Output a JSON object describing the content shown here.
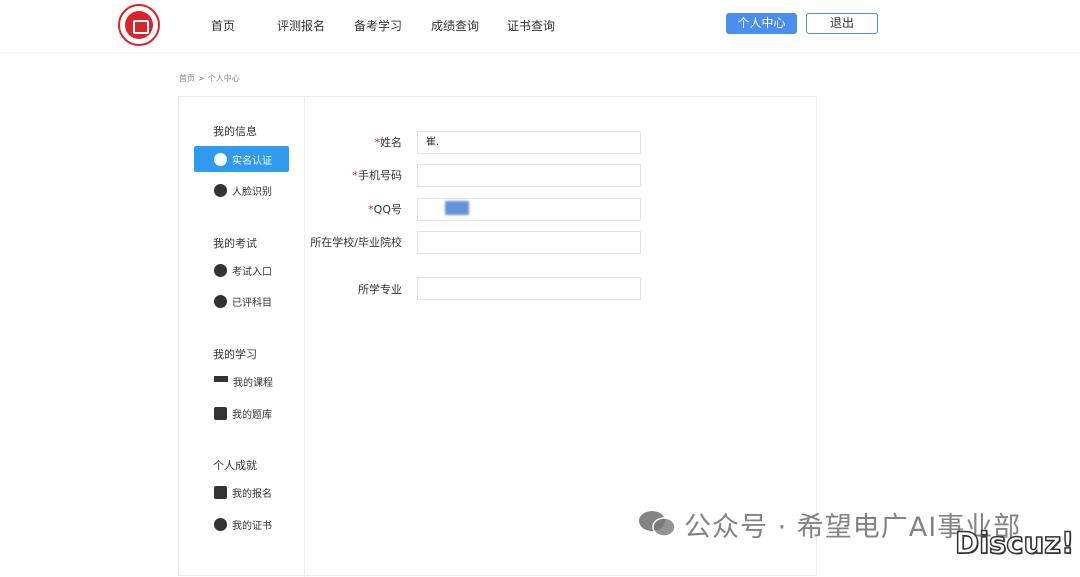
{
  "header": {
    "nav": [
      "首页",
      "评测报名",
      "备考学习",
      "成绩查询",
      "证书查询"
    ],
    "center_button": "个人中心",
    "logout_button": "退出"
  },
  "breadcrumb": [
    "首页",
    ">",
    "个人中心"
  ],
  "sidebar": {
    "groups": [
      {
        "title": "我的信息",
        "items": [
          "实名认证",
          "人脸识别"
        ]
      },
      {
        "title": "我的考试",
        "items": [
          "考试入口",
          "已评科目"
        ]
      },
      {
        "title": "我的学习",
        "items": [
          "我的课程",
          "我的题库"
        ]
      },
      {
        "title": "个人成就",
        "items": [
          "我的报名",
          "我的证书"
        ]
      }
    ],
    "active_item": "实名认证"
  },
  "form": {
    "required_mark": "*",
    "fields": [
      {
        "label": "姓名",
        "value": "崔.",
        "required": true
      },
      {
        "label": "手机号码",
        "value": "",
        "required": true
      },
      {
        "label": "QQ号",
        "value": "",
        "required": true
      },
      {
        "label": "所在学校/毕业院校",
        "value": "",
        "required": false
      },
      {
        "label": "所学专业",
        "value": "",
        "required": false
      }
    ]
  },
  "watermark": {
    "text": "公众号 · 希望电广AI事业部",
    "badge": "Discuz!"
  }
}
